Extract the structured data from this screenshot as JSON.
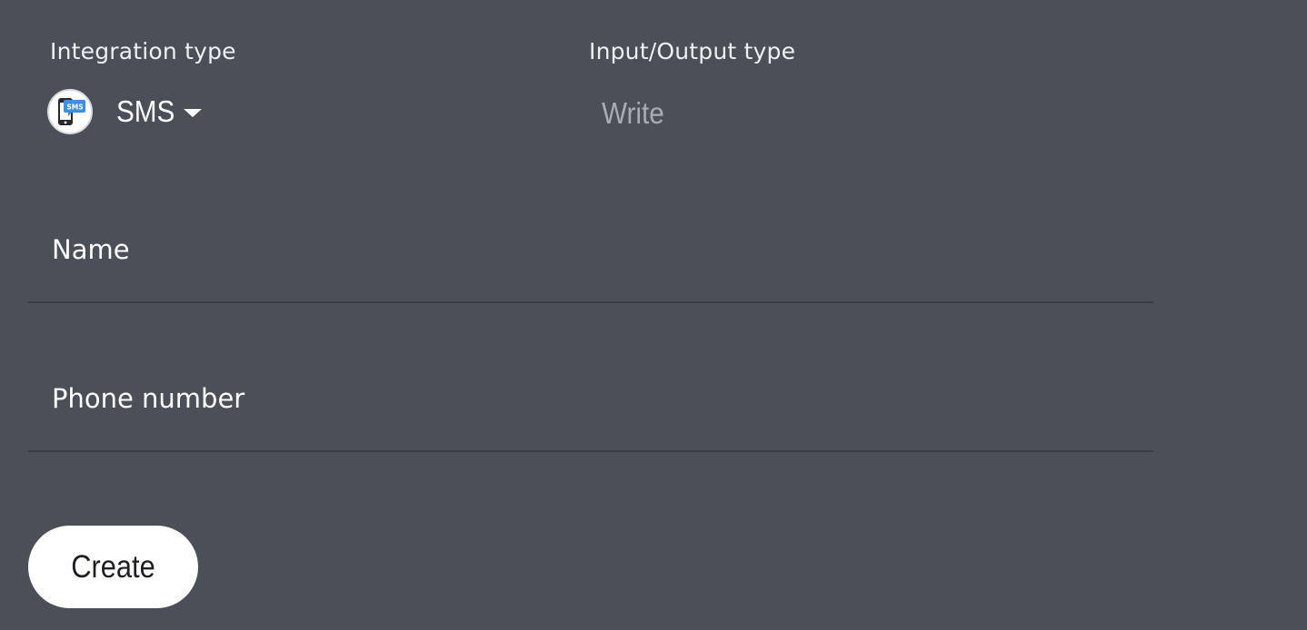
{
  "integration": {
    "label": "Integration type",
    "selected_value": "SMS",
    "icon": "sms-phone-icon",
    "icon_text": "SMS",
    "icon_colors": {
      "badge": "#3d8fe0",
      "phone": "#2a2a2a"
    }
  },
  "io_type": {
    "label": "Input/Output type",
    "value": "Write"
  },
  "form": {
    "name_label": "Name",
    "name_value": "",
    "phone_label": "Phone number",
    "phone_value": ""
  },
  "actions": {
    "create_label": "Create"
  },
  "colors": {
    "background": "#4b4f57",
    "text": "#ffffff",
    "muted_text": "#a9adb3",
    "button_bg": "#ffffff",
    "button_text": "#1e1f22",
    "divider": "#393c42"
  }
}
